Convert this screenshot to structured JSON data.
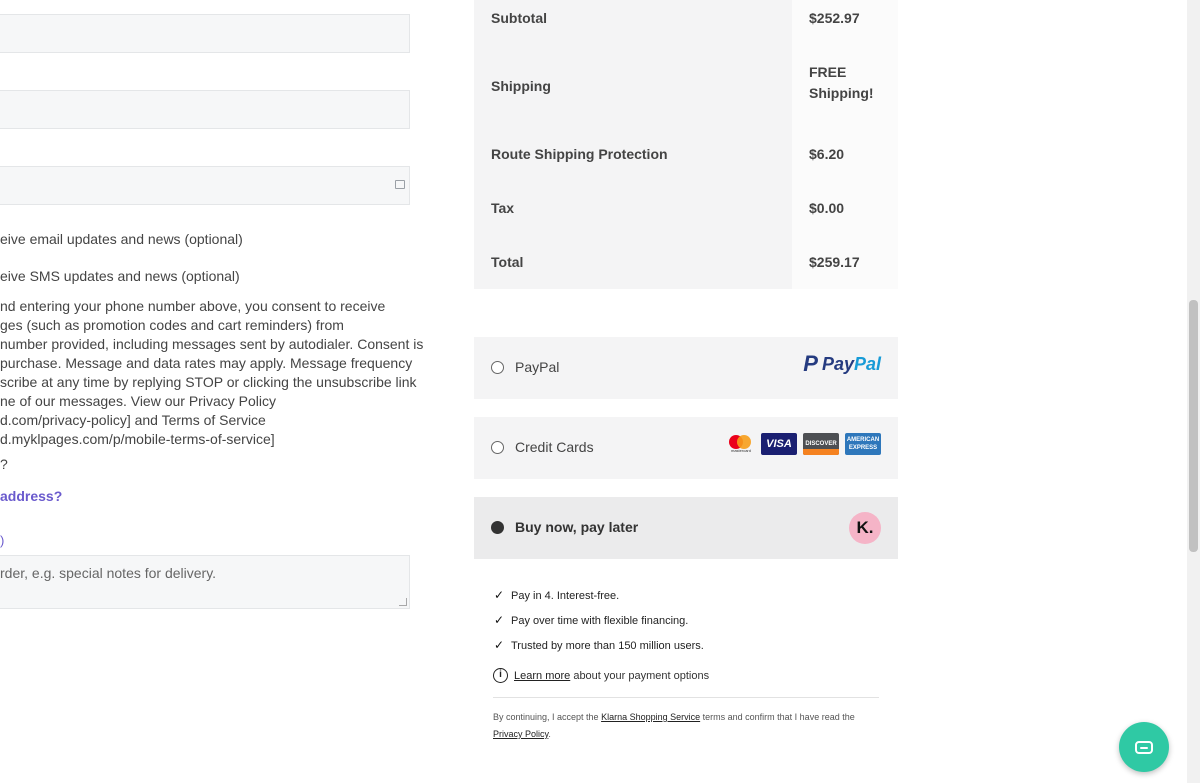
{
  "checkout_form": {
    "email_optin": "eive email updates and news (optional)",
    "sms_optin": "eive SMS updates and news (optional)",
    "consent_lines": [
      "nd entering your phone number above, you consent to receive",
      "ges (such as promotion codes and cart reminders) from",
      "number provided, including messages sent by autodialer. Consent is",
      "purchase. Message and data rates may apply. Message frequency",
      "scribe at any time by replying STOP or clicking the unsubscribe link",
      "ne of our messages. View our Privacy Policy",
      "d.com/privacy-policy] and Terms of Service",
      "d.myklpages.com/p/mobile-terms-of-service]"
    ],
    "question_mark": "?",
    "address_link": "address?",
    "paren_mark": ")",
    "notes_placeholder": "rder, e.g. special notes for delivery."
  },
  "order_summary": {
    "rows": [
      {
        "label": "Subtotal",
        "value": "$252.97"
      },
      {
        "label": "Shipping",
        "value_lines": [
          "FREE",
          "Shipping!"
        ]
      },
      {
        "label": "Route Shipping Protection",
        "value": "$6.20"
      },
      {
        "label": "Tax",
        "value": "$0.00"
      },
      {
        "label": "Total",
        "value": "$259.17"
      }
    ]
  },
  "payment_methods": [
    {
      "label": "PayPal",
      "selected": false,
      "logo_text_a": "Pay",
      "logo_text_b": "Pal"
    },
    {
      "label": "Credit Cards",
      "selected": false,
      "cards": [
        "mastercard",
        "visa",
        "discover",
        "amex"
      ],
      "mc_label": "mastercard",
      "visa_label": "VISA",
      "discover_label": "DISCOVER",
      "amex_label": "AMERICAN EXPRESS"
    },
    {
      "label": "Buy now, pay later",
      "selected": true,
      "badge": "K."
    }
  ],
  "klarna": {
    "bullets": [
      "Pay in 4. Interest-free.",
      "Pay over time with flexible financing.",
      "Trusted by more than 150 million users."
    ],
    "learn_more_link": "Learn more",
    "learn_more_suffix": " about your payment options",
    "legal_prefix": "By continuing, I accept the ",
    "legal_link_1": "Klarna Shopping Service",
    "legal_mid": " terms and confirm that I have read the ",
    "legal_link_2": "Privacy Policy",
    "legal_suffix": "."
  },
  "icons": {
    "check": "✓",
    "info": "i",
    "field_icon": "⊞"
  },
  "colors": {
    "accent_link": "#6a5acd",
    "chat_button": "#2fc9a4",
    "klarna_pink": "#f5b4c7",
    "paypal_dark": "#253b80",
    "paypal_light": "#179bd7"
  }
}
